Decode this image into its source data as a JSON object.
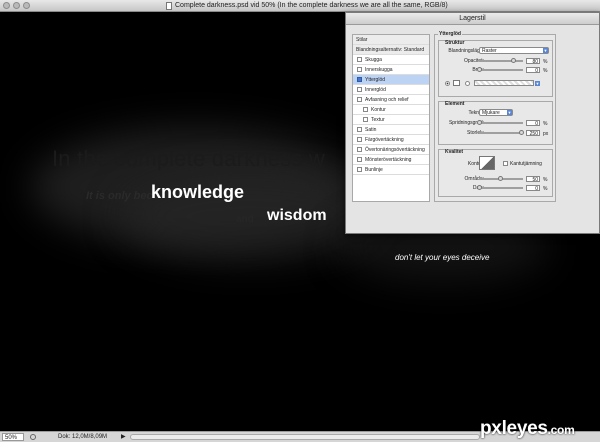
{
  "window": {
    "title": "Complete darkness.psd vid 50% (In the complete darkness we are all the same, RGB/8)"
  },
  "canvas": {
    "ghost_title": "In the complete darkness w",
    "ghost_small1": "It is only bec",
    "ghost_small2": "and",
    "word_knowledge": "knowledge",
    "word_wisdom": "wisdom",
    "caption": "don't let your eyes deceive"
  },
  "dialog": {
    "title": "Lagerstil",
    "styles_header": "Stilar",
    "blend_options": "Blandningsalternativ: Standard",
    "styles": [
      {
        "label": "Skugga",
        "checked": false,
        "indent": false,
        "selected": false
      },
      {
        "label": "Innerskugga",
        "checked": false,
        "indent": false,
        "selected": false
      },
      {
        "label": "Ytterglöd",
        "checked": true,
        "indent": false,
        "selected": true
      },
      {
        "label": "Innerglöd",
        "checked": false,
        "indent": false,
        "selected": false
      },
      {
        "label": "Avfasning och relief",
        "checked": false,
        "indent": false,
        "selected": false
      },
      {
        "label": "Kontur",
        "checked": false,
        "indent": true,
        "selected": false
      },
      {
        "label": "Textur",
        "checked": false,
        "indent": true,
        "selected": false
      },
      {
        "label": "Satin",
        "checked": false,
        "indent": false,
        "selected": false
      },
      {
        "label": "Färgövertäckning",
        "checked": false,
        "indent": false,
        "selected": false
      },
      {
        "label": "Övertonäringsövertäckning",
        "checked": false,
        "indent": false,
        "selected": false
      },
      {
        "label": "Mönsterövertäckning",
        "checked": false,
        "indent": false,
        "selected": false
      },
      {
        "label": "Bunlinje",
        "checked": false,
        "indent": false,
        "selected": false
      }
    ],
    "outer_glow": {
      "legend": "Ytterglöd",
      "structure": {
        "legend": "Struktur",
        "blend_mode_label": "Blandningsläge:",
        "blend_mode_value": "Raster",
        "opacity_label": "Opacitet:",
        "opacity_value": "80",
        "opacity_fraction": 0.8,
        "noise_label": "Brus:",
        "noise_value": "0",
        "noise_fraction": 0.0,
        "unit": "%"
      },
      "elements": {
        "legend": "Element",
        "technique_label": "Teknik:",
        "technique_value": "Mjukare",
        "spread_label": "Spridningsgrad:",
        "spread_value": "0",
        "spread_fraction": 0.0,
        "size_label": "Storlek:",
        "size_value": "250",
        "size_fraction": 1.0,
        "percent_unit": "%",
        "px_unit": "px"
      },
      "quality": {
        "legend": "Kvalitet",
        "contour_label": "Kontur:",
        "anti_alias_label": "Kantutjämning",
        "range_label": "Område:",
        "range_value": "50",
        "range_fraction": 0.5,
        "jitter_label": "Darr:",
        "jitter_value": "0",
        "jitter_fraction": 0.0,
        "unit": "%"
      }
    }
  },
  "statusbar": {
    "zoom": "50%",
    "doc_info": "Dok: 12,0M/8,09M",
    "arrow": "▶"
  },
  "watermark": {
    "name": "pxleyes",
    "suffix": ".com"
  }
}
